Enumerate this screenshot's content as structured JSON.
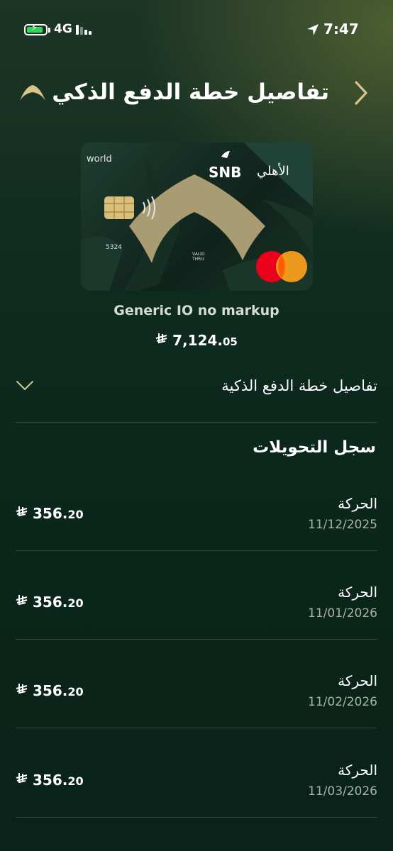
{
  "status_bar": {
    "network": "4G",
    "time": "7:47"
  },
  "header": {
    "title": "تفاصيل خطة الدفع الذكي"
  },
  "card": {
    "tier": "world",
    "brand": "SNB",
    "brand_ar": "الأهلي",
    "last_digits": "5324",
    "valid_label_1": "VALID",
    "valid_label_2": "THRU",
    "name": "Generic IO no markup",
    "balance_whole": "7,124.",
    "balance_decimal": "05",
    "currency_symbol": "⃁"
  },
  "accordion": {
    "label": "تفاصيل خطة الدفع الذكية"
  },
  "transfers": {
    "title": "سجل التحويلات",
    "rows": [
      {
        "label": "الحركة",
        "date": "11/12/2025",
        "amount_whole": "356.",
        "amount_decimal": "20"
      },
      {
        "label": "الحركة",
        "date": "11/01/2026",
        "amount_whole": "356.",
        "amount_decimal": "20"
      },
      {
        "label": "الحركة",
        "date": "11/02/2026",
        "amount_whole": "356.",
        "amount_decimal": "20"
      },
      {
        "label": "الحركة",
        "date": "11/03/2026",
        "amount_whole": "356.",
        "amount_decimal": "20"
      }
    ]
  },
  "colors": {
    "background": "#0e2b1f",
    "accent_gold": "#d7c58a",
    "card_gold": "#a99b72",
    "battery_green": "#35d35f"
  },
  "icons": {
    "back": "chevron-right-icon",
    "logo": "snb-chevron-logo-icon",
    "expand": "chevron-down-icon",
    "location": "location-arrow-icon"
  }
}
